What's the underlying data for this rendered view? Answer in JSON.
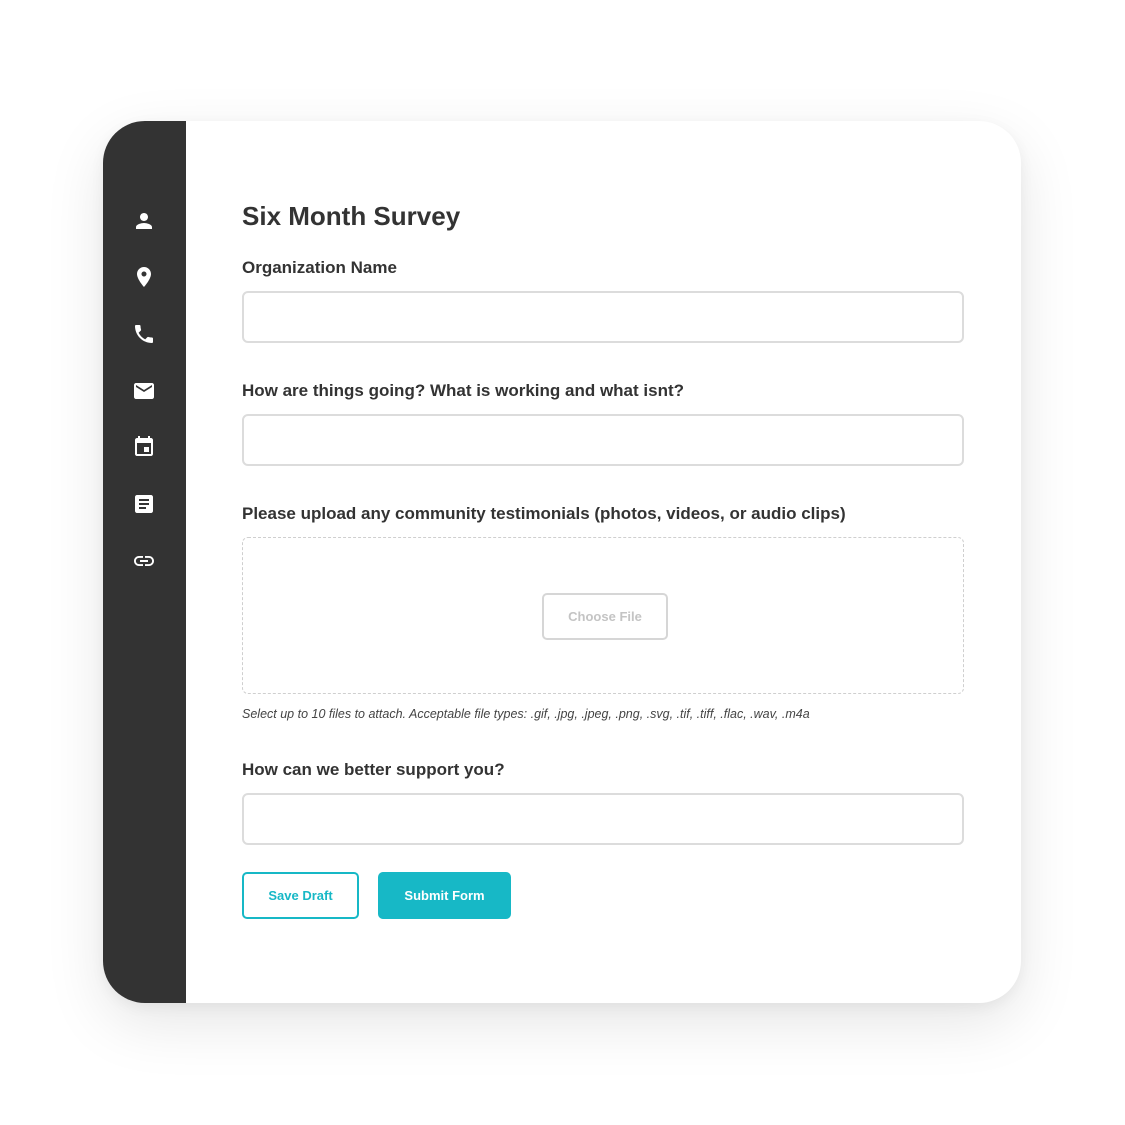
{
  "sidebar": {
    "icons": [
      {
        "name": "user-icon"
      },
      {
        "name": "location-pin-icon"
      },
      {
        "name": "phone-icon"
      },
      {
        "name": "email-icon"
      },
      {
        "name": "calendar-icon"
      },
      {
        "name": "document-icon"
      },
      {
        "name": "link-icon"
      }
    ]
  },
  "form": {
    "title": "Six Month Survey",
    "org_label": "Organization Name",
    "org_value": "",
    "progress_label": "How are things going? What is working and what isnt?",
    "progress_value": "",
    "upload_label": "Please upload any community testimonials (photos, videos, or audio clips)",
    "choose_file_label": "Choose File",
    "upload_help": "Select up to 10 files to attach. Acceptable file types: .gif, .jpg, .jpeg, .png, .svg, .tif, .tiff, .flac, .wav, .m4a",
    "support_label": "How can we better support you?",
    "support_value": "",
    "save_label": "Save Draft",
    "submit_label": "Submit Form"
  },
  "colors": {
    "sidebar_bg": "#333333",
    "accent": "#17b8c6",
    "text": "#333333",
    "input_border": "#dcdcdc"
  }
}
